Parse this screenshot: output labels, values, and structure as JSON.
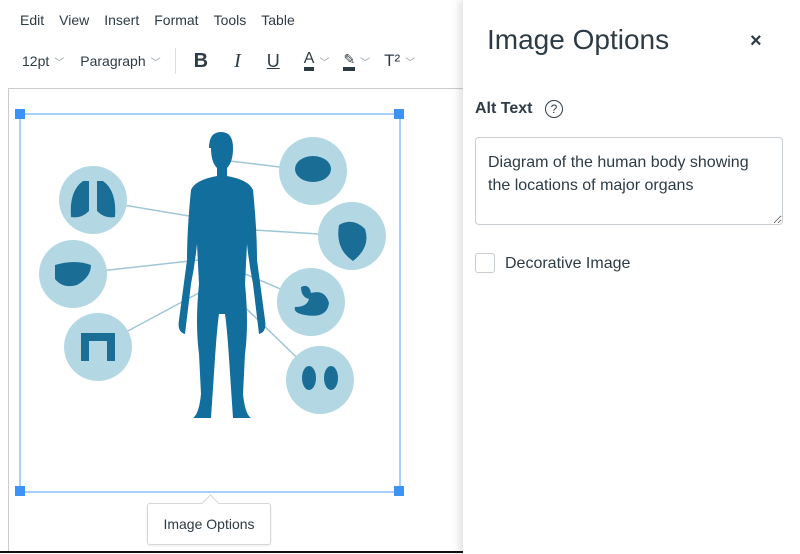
{
  "menu": [
    "Edit",
    "View",
    "Insert",
    "Format",
    "Tools",
    "Table"
  ],
  "toolbar": {
    "font_size": "12pt",
    "block_format": "Paragraph",
    "bold": "B",
    "italic": "I",
    "underline": "U",
    "text_color": "A",
    "superscript": "T²"
  },
  "tooltip": {
    "label": "Image Options"
  },
  "panel": {
    "title": "Image Options",
    "close": "×",
    "alt_text_label": "Alt Text",
    "help": "?",
    "alt_text_value": "Diagram of the human body showing the locations of major organs",
    "decorative_label": "Decorative Image",
    "decorative_checked": false
  },
  "colors": {
    "organ": "#1a6e96",
    "circle": "#b3d8e4",
    "selection": "#3d92f5"
  }
}
